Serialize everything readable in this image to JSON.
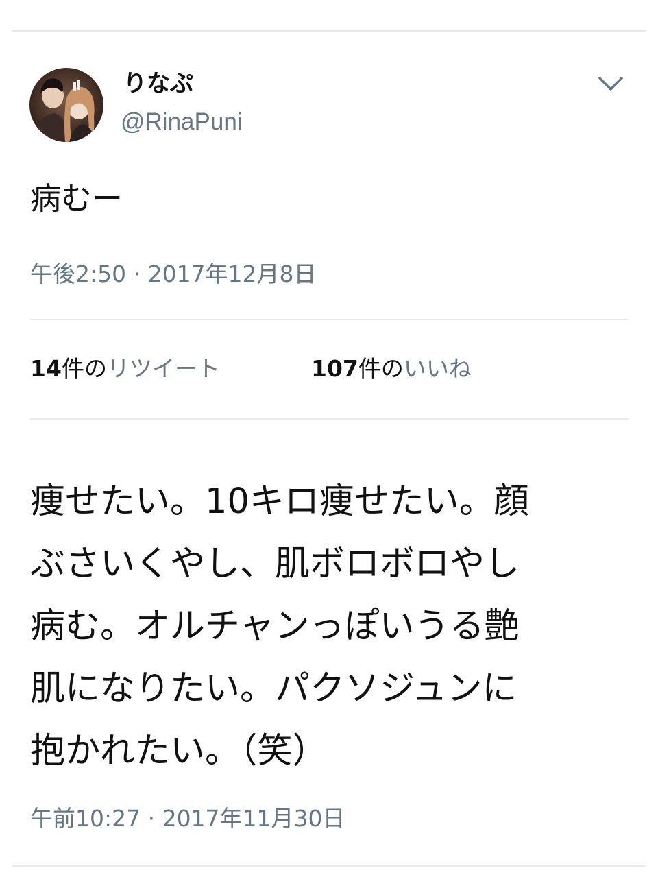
{
  "tweet": {
    "display_name": "りなぷ",
    "handle": "@RinaPuni",
    "text": "病むー",
    "timestamp": "午後2:50 · 2017年12月8日",
    "retweets": {
      "count": "14",
      "unit": "件の",
      "label": "リツイート"
    },
    "likes": {
      "count": "107",
      "unit": "件の",
      "label": "いいね"
    }
  },
  "second_tweet": {
    "lines": [
      "痩せたい。10キロ痩せたい。顔",
      "ぶさいくやし、肌ボロボロやし",
      "病む。オルチャンっぽいうる艶",
      "肌になりたい。パクソジュンに",
      "抱かれたい。（笑）"
    ],
    "timestamp": "午前10:27 · 2017年11月30日"
  },
  "colors": {
    "secondary_text": "#657786",
    "divider": "#e6ecf0",
    "primary_text": "#111111"
  },
  "icons": {
    "more_options": "chevron-down-icon"
  }
}
